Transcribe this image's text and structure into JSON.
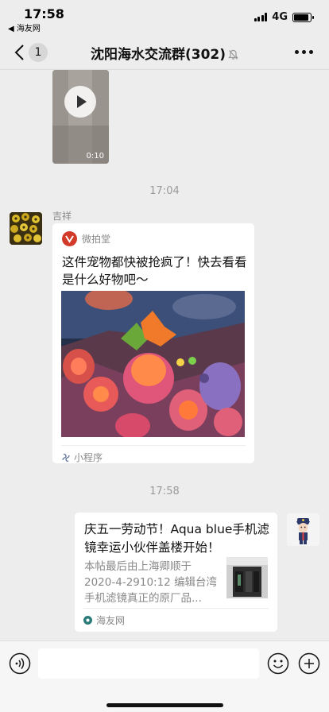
{
  "status_bar": {
    "time": "17:58",
    "back_app": "◀ 海友网",
    "network": "4G",
    "battery_level": 0.9
  },
  "nav": {
    "back_count": "1",
    "title": "沈阳海水交流群(302)"
  },
  "messages": {
    "video": {
      "duration": "0:10"
    },
    "time_1": "17:04",
    "miniprogram": {
      "sender": "吉祥",
      "source": "微拍堂",
      "title": "这件宠物都快被抢疯了！快去看看是什么好物吧～",
      "footer": "小程序"
    },
    "time_2": "17:58",
    "link_card": {
      "title": "庆五一劳动节！Aqua blue手机滤镜幸运小伙伴盖楼开始！",
      "description": "本帖最后由上海卿顺于 2020-4-2910:12 编辑台湾手机滤镜真正的原厂品...",
      "source": "海友网"
    }
  },
  "input": {
    "placeholder": ""
  }
}
